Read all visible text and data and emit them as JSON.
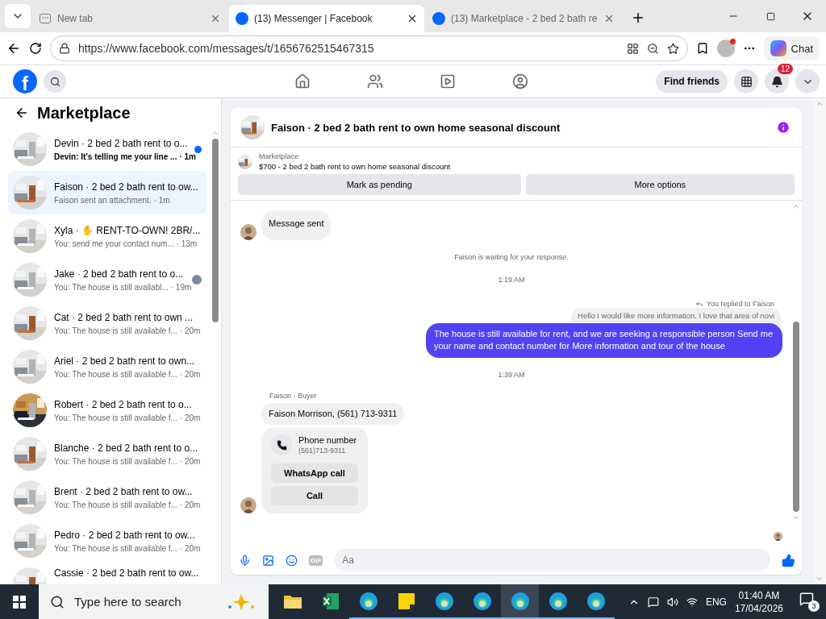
{
  "browser": {
    "tabs": [
      {
        "kind": "newtab",
        "title": "New tab",
        "selected": false
      },
      {
        "kind": "facebook",
        "title": "(13) Messenger | Facebook",
        "selected": true
      },
      {
        "kind": "facebook",
        "title": "(13) Marketplace - 2 bed 2 bath re",
        "selected": false
      }
    ],
    "url": "https://www.facebook.com/messages/t/1656762515467315",
    "chat_button": "Chat"
  },
  "topbar": {
    "logo": "f",
    "nav": [
      {
        "kind": "home",
        "selected": false
      },
      {
        "kind": "friends",
        "selected": false
      },
      {
        "kind": "video",
        "selected": false
      },
      {
        "kind": "groups",
        "selected": false
      }
    ],
    "find_friends": "Find friends",
    "notification_count": "12"
  },
  "sidebar": {
    "title": "Marketplace",
    "conversations": [
      {
        "title": "Devin · 2 bed 2 bath rent to o...",
        "preview": "Devin: It's telling me your line ...",
        "time": "· 1m",
        "unread": true,
        "seen": false,
        "selected": false
      },
      {
        "title": "Faison · 2 bed 2 bath rent to ow...",
        "preview": "Faison sent an attachment.",
        "time": "· 1m",
        "unread": false,
        "seen": false,
        "selected": true
      },
      {
        "title": "Xyla · ✋ RENT-TO-OWN! 2BR/...",
        "preview": "You: send me your contact num...",
        "time": "· 13m",
        "unread": false,
        "seen": false,
        "selected": false
      },
      {
        "title": "Jake · 2 bed 2 bath rent to o...",
        "preview": "You: The house is still availabl...",
        "time": "· 19m",
        "unread": false,
        "seen": true,
        "selected": false
      },
      {
        "title": "Cat · 2 bed 2 bath rent to own ...",
        "preview": "You: The house is still available f...",
        "time": "· 20m",
        "unread": false,
        "seen": false,
        "selected": false
      },
      {
        "title": "Ariel · 2 bed 2 bath rent to own...",
        "preview": "You: The house is still available f...",
        "time": "· 20m",
        "unread": false,
        "seen": false,
        "selected": false
      },
      {
        "title": "Robert · 2 bed 2 bath rent to o...",
        "preview": "You: The house is still available f...",
        "time": "· 20m",
        "unread": false,
        "seen": false,
        "selected": false
      },
      {
        "title": "Blanche · 2 bed 2 bath rent to o...",
        "preview": "You: The house is still available f...",
        "time": "· 20m",
        "unread": false,
        "seen": false,
        "selected": false
      },
      {
        "title": "Brent · 2 bed 2 bath rent to ow...",
        "preview": "You: The house is still available f...",
        "time": "· 20m",
        "unread": false,
        "seen": false,
        "selected": false
      },
      {
        "title": "Pedro · 2 bed 2 bath rent to ow...",
        "preview": "You: The house is still available f...",
        "time": "· 20m",
        "unread": false,
        "seen": false,
        "selected": false
      },
      {
        "title": "Cassie · 2 bed 2 bath rent to ow..."
      }
    ]
  },
  "chat": {
    "title": "Faison · 2 bed 2 bath rent to own home seasonal discount",
    "listing": {
      "label": "Marketplace",
      "text": "$700 - 2 bed 2 bath rent to own home seasonal discount",
      "actions": [
        "Mark as pending",
        "More options"
      ]
    },
    "messages": [
      {
        "kind": "incoming",
        "text": "Message sent",
        "avatar": true
      },
      {
        "kind": "notice",
        "text": "Faison is waiting for your response."
      },
      {
        "kind": "time",
        "text": "1:19 AM"
      },
      {
        "kind": "reply_label",
        "text": "You replied to Faison"
      },
      {
        "kind": "quote",
        "text": "Hello I would like more information. I love that area of novi"
      },
      {
        "kind": "outgoing",
        "text": "The  house is still available for rent, and we are seeking a responsible person  Send me your name and contact number for More information and tour of the house"
      },
      {
        "kind": "time",
        "text": "1:39 AM"
      },
      {
        "kind": "sender",
        "text": "Faison · Buyer"
      },
      {
        "kind": "incoming",
        "text": "Faison Morrison, (561) 713-9311",
        "avatar": false
      },
      {
        "kind": "contact",
        "title": "Phone number",
        "number": "(561)713-9311",
        "actions": [
          "WhatsApp call",
          "Call"
        ],
        "avatar": true
      }
    ],
    "composer": {
      "placeholder": "Aa",
      "gif": "GIF"
    }
  },
  "taskbar": {
    "search_placeholder": "Type here to search",
    "apps": [
      {
        "kind": "folder",
        "running": false,
        "selected": false
      },
      {
        "kind": "excel",
        "running": false,
        "selected": false
      },
      {
        "kind": "edge",
        "running": true,
        "selected": false
      },
      {
        "kind": "notes",
        "running": true,
        "selected": false
      },
      {
        "kind": "edge",
        "running": true,
        "selected": false
      },
      {
        "kind": "edge",
        "running": true,
        "selected": false
      },
      {
        "kind": "edge",
        "running": true,
        "selected": true
      },
      {
        "kind": "edge",
        "running": true,
        "selected": false
      },
      {
        "kind": "edge",
        "running": true,
        "selected": false
      }
    ],
    "language": "ENG",
    "time": "01:40 AM",
    "date": "17/04/2026",
    "notifications": "3"
  }
}
